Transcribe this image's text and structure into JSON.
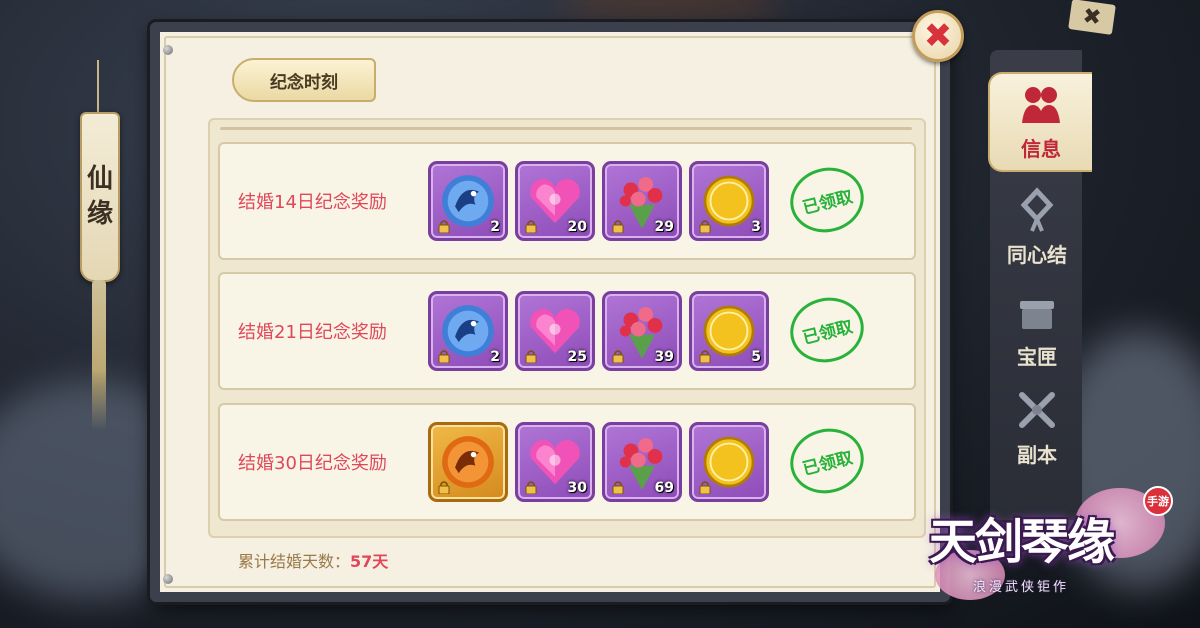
{
  "side_tag": {
    "chars": [
      "仙",
      "缘"
    ]
  },
  "title_tab": "纪念时刻",
  "rows": [
    {
      "label": "结婚14日纪念奖励",
      "status": "已领取",
      "items": [
        {
          "icon": "blue-dragon-orb-icon",
          "count": "2",
          "frame": "purple"
        },
        {
          "icon": "pink-heart-gem-icon",
          "count": "20",
          "frame": "purple"
        },
        {
          "icon": "rose-bouquet-icon",
          "count": "29",
          "frame": "purple"
        },
        {
          "icon": "gold-xian-coin-icon",
          "count": "3",
          "frame": "purple"
        }
      ]
    },
    {
      "label": "结婚21日纪念奖励",
      "status": "已领取",
      "items": [
        {
          "icon": "blue-dragon-orb-icon",
          "count": "2",
          "frame": "purple"
        },
        {
          "icon": "pink-heart-gem-icon",
          "count": "25",
          "frame": "purple"
        },
        {
          "icon": "rose-bouquet-icon",
          "count": "39",
          "frame": "purple"
        },
        {
          "icon": "gold-xian-coin-icon",
          "count": "5",
          "frame": "purple"
        }
      ]
    },
    {
      "label": "结婚30日纪念奖励",
      "status": "已领取",
      "items": [
        {
          "icon": "orange-dragon-orb-icon",
          "count": "",
          "frame": "gold"
        },
        {
          "icon": "pink-heart-gem-icon",
          "count": "30",
          "frame": "purple"
        },
        {
          "icon": "rose-bouquet-icon",
          "count": "69",
          "frame": "purple"
        },
        {
          "icon": "gold-xian-coin-icon",
          "count": "",
          "frame": "purple"
        }
      ]
    }
  ],
  "total": {
    "label": "累计结婚天数：",
    "value": "57天"
  },
  "close": {
    "icon": "close-icon",
    "glyph": "✖"
  },
  "corner_close": {
    "glyph": "✖"
  },
  "side_tabs": [
    {
      "label": "信息",
      "icon": "couple-icon",
      "active": true
    },
    {
      "label": "同心结",
      "icon": "knot-icon",
      "active": false
    },
    {
      "label": "宝匣",
      "icon": "chest-icon",
      "active": false
    },
    {
      "label": "副本",
      "icon": "crossed-swords-icon",
      "active": false
    }
  ],
  "logo": {
    "title": "天剑琴缘",
    "subtitle": "浪漫武侠钜作",
    "badge": "手游"
  },
  "colors": {
    "accent_red": "#e0485a",
    "stamp_green": "#29b23a",
    "slot_purple": "#8e4cb8",
    "slot_gold": "#d48a1c"
  }
}
